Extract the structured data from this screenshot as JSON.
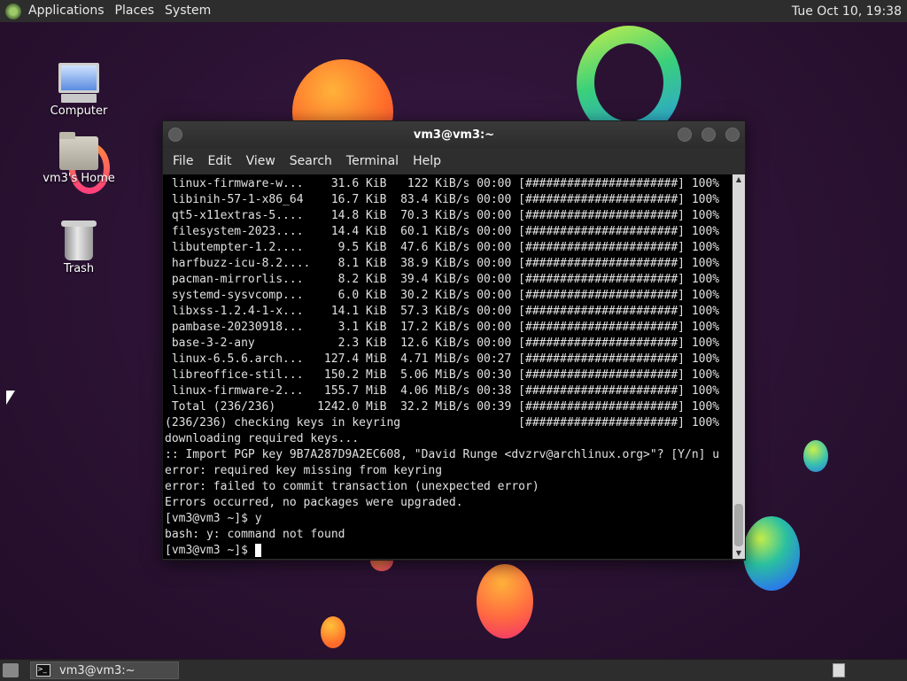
{
  "top_panel": {
    "menus": [
      "Applications",
      "Places",
      "System"
    ],
    "clock": "Tue Oct 10, 19:38"
  },
  "desktop": {
    "icons": [
      "Computer",
      "vm3's Home",
      "Trash"
    ]
  },
  "terminal": {
    "title": "vm3@vm3:~",
    "menus": [
      "File",
      "Edit",
      "View",
      "Search",
      "Terminal",
      "Help"
    ],
    "lines": [
      " linux-firmware-w...    31.6 KiB   122 KiB/s 00:00 [######################] 100%",
      " libinih-57-1-x86_64    16.7 KiB  83.4 KiB/s 00:00 [######################] 100%",
      " qt5-x11extras-5....    14.8 KiB  70.3 KiB/s 00:00 [######################] 100%",
      " filesystem-2023....    14.4 KiB  60.1 KiB/s 00:00 [######################] 100%",
      " libutempter-1.2....     9.5 KiB  47.6 KiB/s 00:00 [######################] 100%",
      " harfbuzz-icu-8.2....    8.1 KiB  38.9 KiB/s 00:00 [######################] 100%",
      " pacman-mirrorlis...     8.2 KiB  39.4 KiB/s 00:00 [######################] 100%",
      " systemd-sysvcomp...     6.0 KiB  30.2 KiB/s 00:00 [######################] 100%",
      " libxss-1.2.4-1-x...    14.1 KiB  57.3 KiB/s 00:00 [######################] 100%",
      " pambase-20230918...     3.1 KiB  17.2 KiB/s 00:00 [######################] 100%",
      " base-3-2-any            2.3 KiB  12.6 KiB/s 00:00 [######################] 100%",
      " linux-6.5.6.arch...   127.4 MiB  4.71 MiB/s 00:27 [######################] 100%",
      " libreoffice-stil...   150.2 MiB  5.06 MiB/s 00:30 [######################] 100%",
      " linux-firmware-2...   155.7 MiB  4.06 MiB/s 00:38 [######################] 100%",
      " Total (236/236)      1242.0 MiB  32.2 MiB/s 00:39 [######################] 100%",
      "(236/236) checking keys in keyring                 [######################] 100%",
      "downloading required keys...",
      ":: Import PGP key 9B7A287D9A2EC608, \"David Runge <dvzrv@archlinux.org>\"? [Y/n] u",
      "error: required key missing from keyring",
      "error: failed to commit transaction (unexpected error)",
      "Errors occurred, no packages were upgraded.",
      "[vm3@vm3 ~]$ y",
      "bash: y: command not found"
    ],
    "prompt": "[vm3@vm3 ~]$ "
  },
  "taskbar": {
    "task_label": "vm3@vm3:~"
  }
}
